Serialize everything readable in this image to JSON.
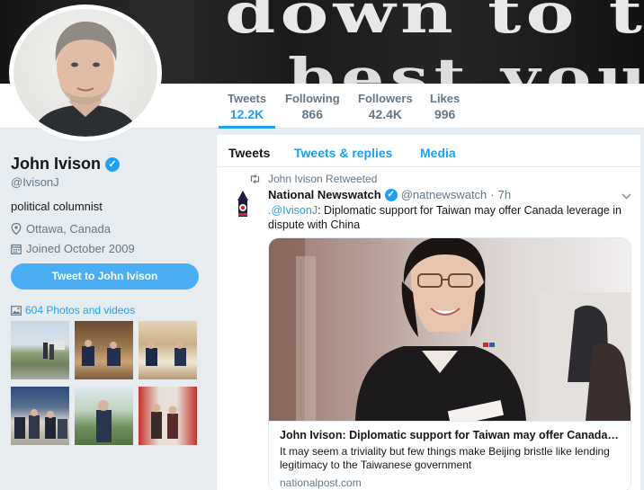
{
  "banner": {
    "line1": "down to their li",
    "line2": "best you with"
  },
  "nav": {
    "tweets": {
      "label": "Tweets",
      "value": "12.2K"
    },
    "following": {
      "label": "Following",
      "value": "866"
    },
    "followers": {
      "label": "Followers",
      "value": "42.4K"
    },
    "likes": {
      "label": "Likes",
      "value": "996"
    }
  },
  "profile": {
    "name": "John Ivison",
    "handle": "@IvisonJ",
    "bio": "political columnist",
    "location": "Ottawa, Canada",
    "joined": "Joined October 2009",
    "tweet_button": "Tweet to John Ivison",
    "photos_link": "604 Photos and videos"
  },
  "timeline": {
    "tabs": [
      "Tweets",
      "Tweets & replies",
      "Media"
    ],
    "retweet_line": "John Ivison Retweeted",
    "tweet": {
      "author": "National Newswatch",
      "handle": "@natnewswatch",
      "separator": "·",
      "time": "7h",
      "text_prefix": ".",
      "mention": "@IvisonJ",
      "text": ": Diplomatic support for Taiwan may offer Canada leverage in dispute with China"
    },
    "card": {
      "title": "John Ivison: Diplomatic support for Taiwan may offer Canada le...",
      "description": "It may seem a triviality but few things make Beijing bristle like lending legitimacy to the Taiwanese government",
      "url": "nationalpost.com"
    }
  },
  "colors": {
    "accent": "#1da1f2",
    "button": "#4aaef5",
    "page_bg": "#e6ecf0",
    "muted": "#657786"
  },
  "icons": [
    "verified-icon",
    "location-pin-icon",
    "calendar-icon",
    "photo-icon",
    "retweet-icon",
    "chevron-down-icon"
  ]
}
